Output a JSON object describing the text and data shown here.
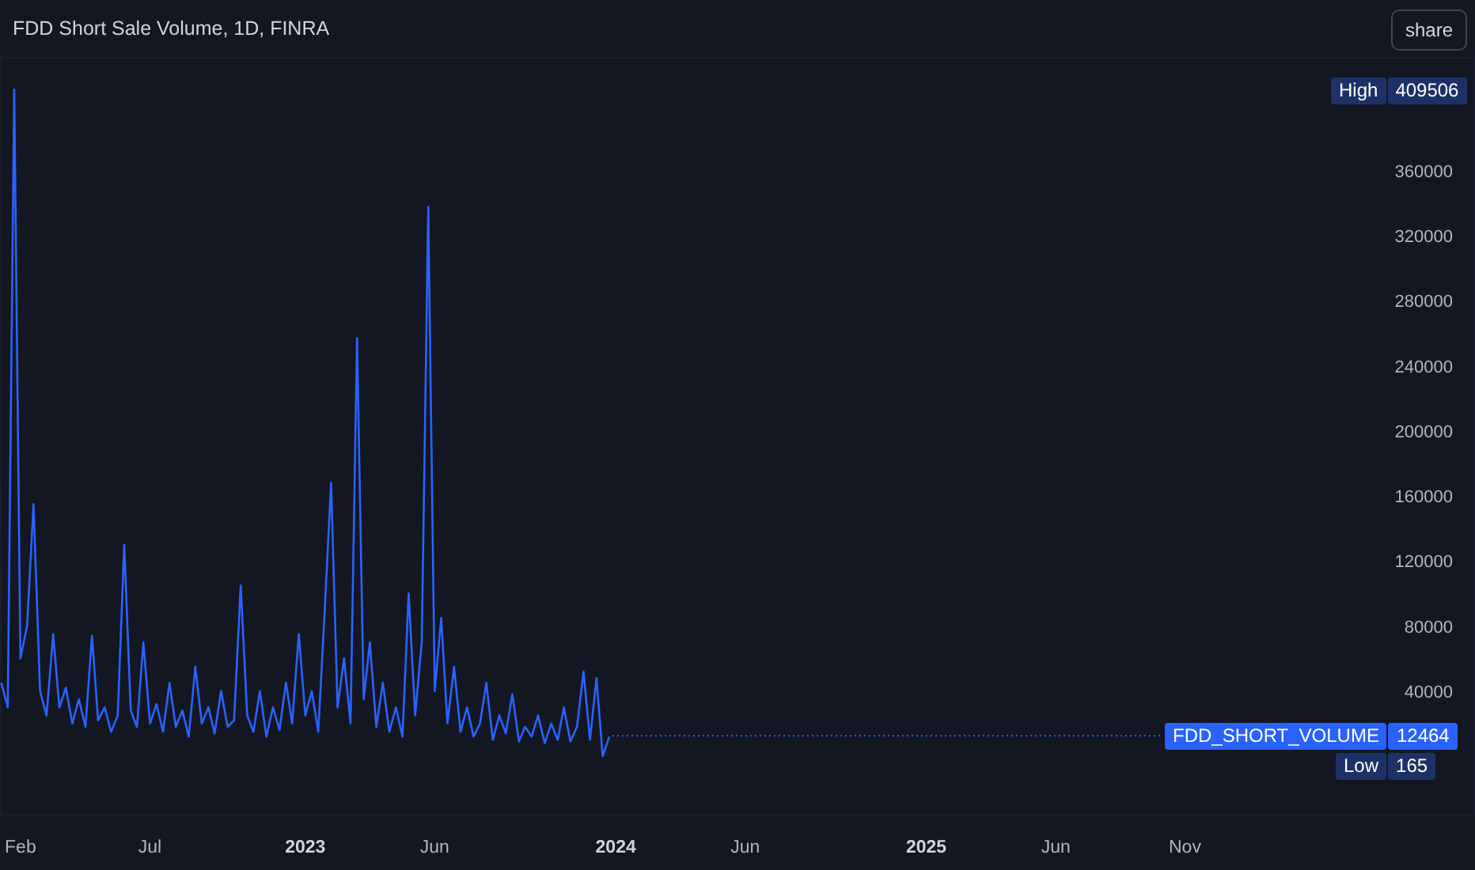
{
  "header": {
    "title": "FDD Short Sale Volume, 1D, FINRA",
    "share_button": "share"
  },
  "chart": {
    "chart_data": {
      "type": "line",
      "x": [
        2022.021,
        2022.042,
        2022.063,
        2022.083,
        2022.104,
        2022.125,
        2022.146,
        2022.167,
        2022.188,
        2022.208,
        2022.229,
        2022.25,
        2022.271,
        2022.292,
        2022.313,
        2022.333,
        2022.354,
        2022.375,
        2022.396,
        2022.417,
        2022.438,
        2022.458,
        2022.479,
        2022.5,
        2022.521,
        2022.542,
        2022.563,
        2022.583,
        2022.604,
        2022.625,
        2022.646,
        2022.667,
        2022.688,
        2022.708,
        2022.729,
        2022.75,
        2022.771,
        2022.792,
        2022.813,
        2022.833,
        2022.854,
        2022.875,
        2022.896,
        2022.917,
        2022.938,
        2022.958,
        2022.979,
        2023,
        2023.021,
        2023.042,
        2023.063,
        2023.083,
        2023.104,
        2023.125,
        2023.146,
        2023.167,
        2023.188,
        2023.208,
        2023.229,
        2023.25,
        2023.271,
        2023.292,
        2023.313,
        2023.333,
        2023.354,
        2023.375,
        2023.396,
        2023.417,
        2023.438,
        2023.458,
        2023.479,
        2023.5,
        2023.521,
        2023.542,
        2023.563,
        2023.583,
        2023.604,
        2023.625,
        2023.646,
        2023.667,
        2023.688,
        2023.708,
        2023.729,
        2023.75,
        2023.771,
        2023.792,
        2023.813,
        2023.833,
        2023.854,
        2023.875,
        2023.896,
        2023.917,
        2023.938,
        2023.958,
        2023.979
      ],
      "series": [
        {
          "name": "FDD_SHORT_VOLUME",
          "color": "#2962ff",
          "values": [
            45000,
            30000,
            410000,
            60000,
            80000,
            155000,
            40000,
            25000,
            75000,
            30000,
            42000,
            20000,
            35000,
            18000,
            74000,
            22000,
            30000,
            15000,
            25000,
            130000,
            28000,
            18000,
            70000,
            20000,
            32000,
            15000,
            45000,
            18000,
            28000,
            12000,
            55000,
            20000,
            30000,
            14000,
            40000,
            18000,
            22000,
            105000,
            25000,
            15000,
            40000,
            12000,
            30000,
            16000,
            45000,
            20000,
            75000,
            25000,
            40000,
            15000,
            90000,
            168000,
            30000,
            60000,
            20000,
            257000,
            35000,
            70000,
            18000,
            45000,
            15000,
            30000,
            12000,
            100000,
            25000,
            70000,
            338000,
            40000,
            85000,
            20000,
            55000,
            15000,
            30000,
            12000,
            20000,
            45000,
            10000,
            25000,
            14000,
            38000,
            9000,
            18000,
            12000,
            25000,
            8000,
            20000,
            10000,
            30000,
            9000,
            18000,
            52000,
            10000,
            48000,
            0,
            12000
          ]
        }
      ],
      "xticks": [
        {
          "value": 2022.083,
          "label": "Feb"
        },
        {
          "value": 2022.5,
          "label": "Jul"
        },
        {
          "value": 2023,
          "label": "2023"
        },
        {
          "value": 2023.417,
          "label": "Jun"
        },
        {
          "value": 2024,
          "label": "2024"
        },
        {
          "value": 2024.417,
          "label": "Jun"
        },
        {
          "value": 2025,
          "label": "2025"
        },
        {
          "value": 2025.417,
          "label": "Jun"
        },
        {
          "value": 2025.833,
          "label": "Nov"
        }
      ],
      "xlim": [
        2022.017,
        2026.767
      ],
      "ylim": [
        -36000,
        430000
      ],
      "yticks": [
        40000,
        80000,
        120000,
        160000,
        200000,
        240000,
        280000,
        320000,
        360000
      ]
    },
    "markers": [
      {
        "kind": "high",
        "label": "High",
        "value": "409506"
      },
      {
        "kind": "last",
        "value": "12464"
      },
      {
        "kind": "low",
        "label": "Low",
        "value": "165"
      }
    ]
  }
}
